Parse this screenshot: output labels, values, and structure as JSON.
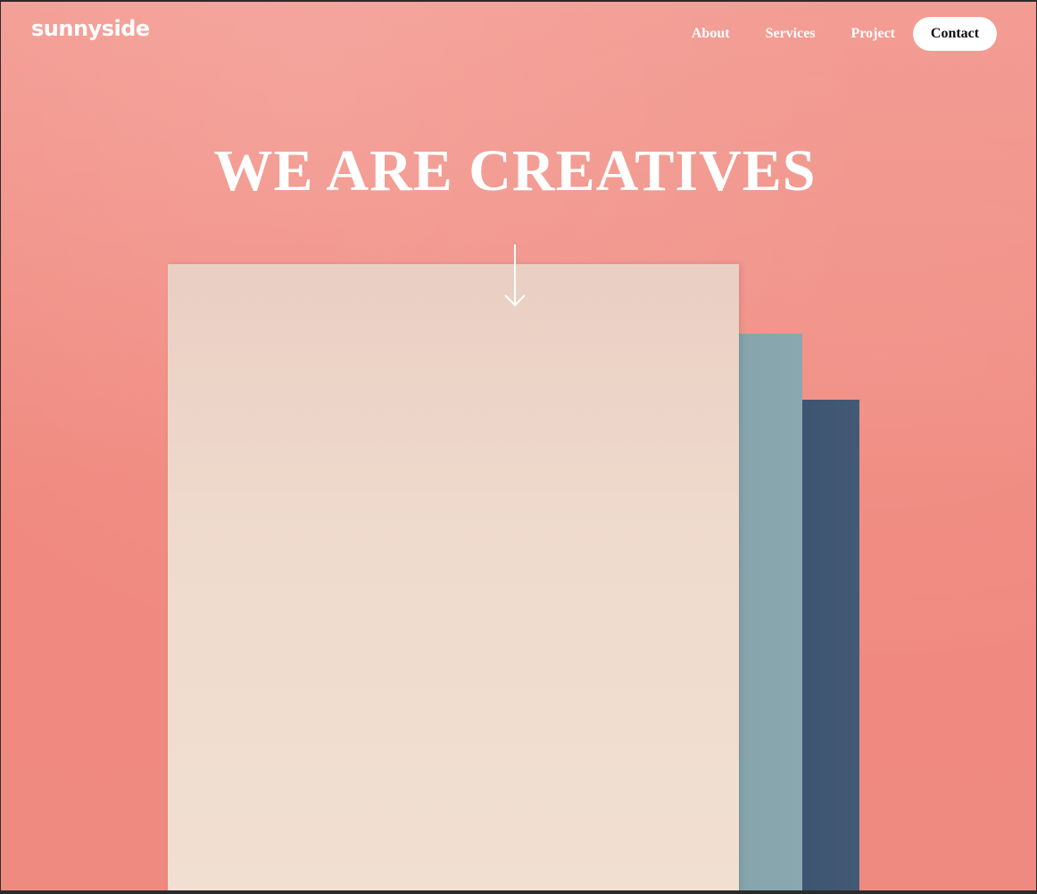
{
  "brand": {
    "logo_text": "sunnyside"
  },
  "nav": {
    "links": [
      {
        "label": "About"
      },
      {
        "label": "Services"
      },
      {
        "label": "Project"
      }
    ],
    "contact_label": "Contact"
  },
  "hero": {
    "title": "WE ARE CREATIVES",
    "scroll_icon": "arrow-down-icon"
  },
  "colors": {
    "background": "#f0897f",
    "paper_cream": "#efdbcd",
    "paper_blue": "#8aa8b0",
    "paper_navy": "#435a76",
    "text": "#ffffff",
    "button_bg": "#ffffff",
    "button_text": "#0e0e0e"
  }
}
